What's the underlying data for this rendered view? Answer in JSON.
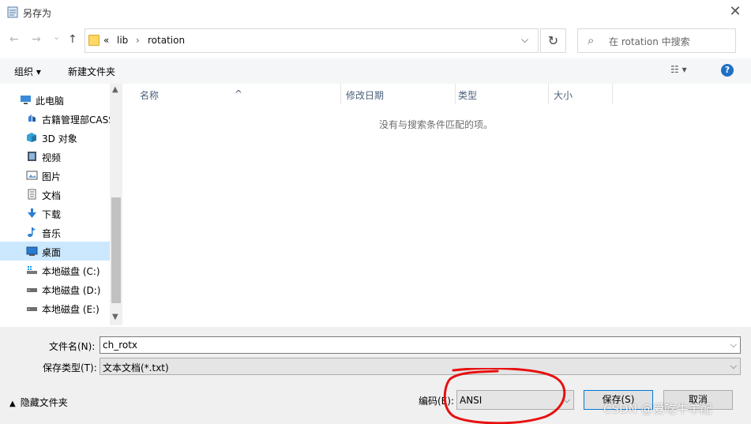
{
  "window": {
    "title": "另存为",
    "close": "✕"
  },
  "nav": {
    "back": "←",
    "forward": "→",
    "recent": "⌄",
    "up": "↑",
    "path_prefix": "«",
    "path": [
      "lib",
      "rotation"
    ],
    "path_sep": "›",
    "refresh": "↻",
    "search_placeholder": "在 rotation 中搜索"
  },
  "toolbar": {
    "organize": "组织 ▾",
    "new_folder": "新建文件夹",
    "view": "☷ ▾",
    "help": "?"
  },
  "sidebar": {
    "items": [
      {
        "label": "此电脑",
        "icon": "pc-icon"
      },
      {
        "label": "古籍管理部CASS",
        "icon": "cloud-drive-icon"
      },
      {
        "label": "3D 对象",
        "icon": "3d-objects-icon"
      },
      {
        "label": "视频",
        "icon": "video-icon"
      },
      {
        "label": "图片",
        "icon": "pictures-icon"
      },
      {
        "label": "文档",
        "icon": "documents-icon"
      },
      {
        "label": "下载",
        "icon": "download-icon"
      },
      {
        "label": "音乐",
        "icon": "music-icon"
      },
      {
        "label": "桌面",
        "icon": "desktop-icon",
        "selected": true
      },
      {
        "label": "本地磁盘 (C:)",
        "icon": "drive-c-icon"
      },
      {
        "label": "本地磁盘 (D:)",
        "icon": "drive-icon"
      },
      {
        "label": "本地磁盘 (E:)",
        "icon": "drive-icon"
      }
    ]
  },
  "columns": [
    "名称",
    "修改日期",
    "类型",
    "大小"
  ],
  "empty_message": "没有与搜索条件匹配的项。",
  "form": {
    "filename_label": "文件名(N):",
    "filename_value": "ch_rotx",
    "filetype_label": "保存类型(T):",
    "filetype_value": "文本文档(*.txt)",
    "hide_folders": "隐藏文件夹",
    "encoding_label": "编码(E):",
    "encoding_value": "ANSI",
    "save": "保存(S)",
    "cancel": "取消"
  },
  "watermark": "CSDN @爱吃牛羊配",
  "colors": {
    "selected_bg": "#cce8ff",
    "annotation": "#e81010",
    "help": "#1f6fc5"
  }
}
